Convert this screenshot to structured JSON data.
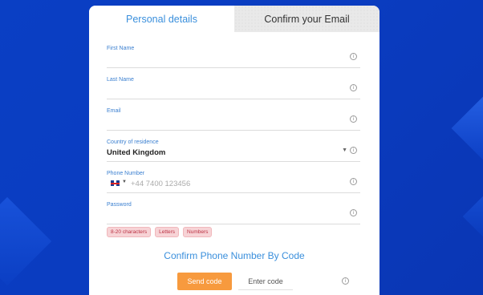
{
  "tabs": [
    {
      "label": "Personal details",
      "active": true
    },
    {
      "label": "Confirm your Email",
      "active": false
    }
  ],
  "fields": {
    "first_name": {
      "label": "First Name",
      "value": ""
    },
    "last_name": {
      "label": "Last Name",
      "value": ""
    },
    "email": {
      "label": "Email",
      "value": ""
    },
    "country": {
      "label": "Country of residence",
      "value": "United Kingdom"
    },
    "phone": {
      "label": "Phone Number",
      "placeholder": "+44 7400 123456",
      "flag": "uk-flag-icon"
    },
    "password": {
      "label": "Password",
      "value": ""
    }
  },
  "password_rules": [
    "8-20 characters",
    "Letters",
    "Numbers"
  ],
  "confirm_phone": {
    "heading": "Confirm Phone Number By Code",
    "send_label": "Send code",
    "code_placeholder": "Enter code"
  },
  "colors": {
    "background": "#0a3cc0",
    "accent_blue": "#3a8fdc",
    "send_button": "#f79a3e",
    "rule_pill_bg": "#f7d3d6"
  }
}
